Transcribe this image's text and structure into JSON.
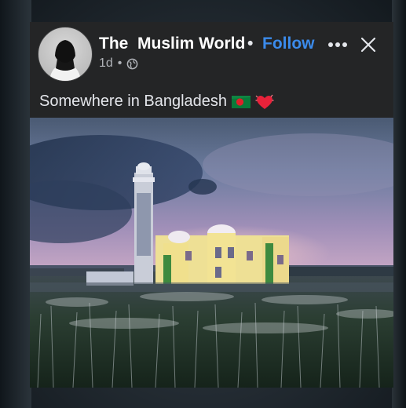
{
  "post": {
    "page_name": "The  Muslim World",
    "separator": "•",
    "follow_label": "Follow",
    "time": "1d",
    "meta_sep": "•",
    "caption": "Somewhere in Bangladesh"
  },
  "icons": {
    "avatar": "profile-avatar",
    "more": "more-horizontal-icon",
    "close": "close-icon",
    "audience": "globe-icon",
    "flag": "bangladesh-flag-icon",
    "heart": "red-heart-icon"
  },
  "colors": {
    "card_bg": "#242526",
    "follow": "#3b8beb",
    "text": "#ffffff",
    "meta": "#b0b3b8"
  }
}
